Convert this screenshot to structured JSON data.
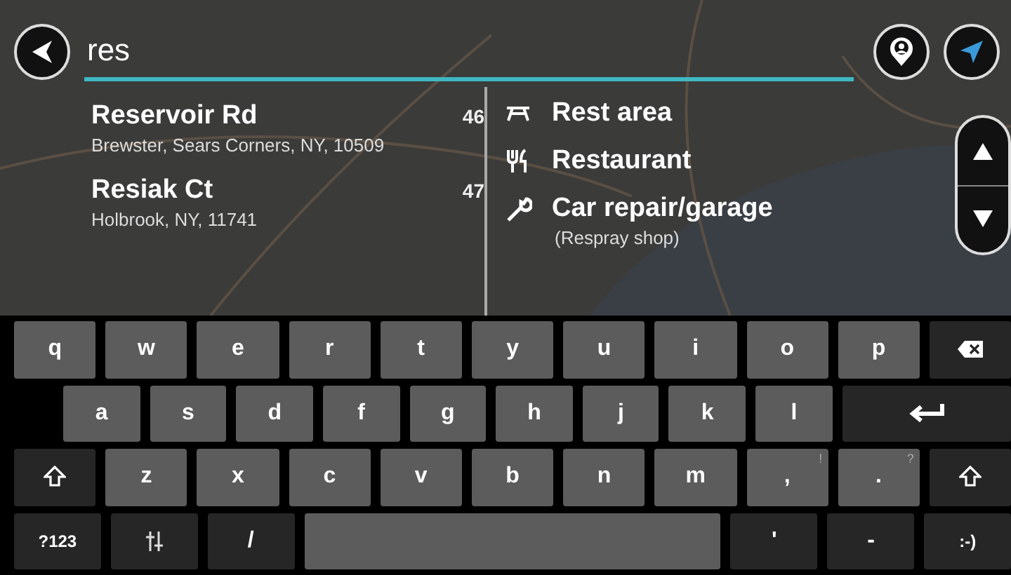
{
  "search": {
    "value": "res"
  },
  "address_results": [
    {
      "name": "Reservoir Rd",
      "address": "Brewster, Sears Corners, NY, 10509",
      "distance": "46"
    },
    {
      "name": "Resiak Ct",
      "address": "Holbrook, NY, 11741",
      "distance": "47"
    }
  ],
  "category_results": [
    {
      "kind": "rest-area",
      "label": "Rest area"
    },
    {
      "kind": "restaurant",
      "label": "Restaurant"
    },
    {
      "kind": "car-repair",
      "label": "Car repair/garage",
      "sublabel": "(Respray shop)"
    }
  ],
  "keyboard": {
    "rows": [
      [
        {
          "kind": "char",
          "label": "q",
          "dark": false
        },
        {
          "kind": "char",
          "label": "w",
          "dark": false
        },
        {
          "kind": "char",
          "label": "e",
          "dark": false
        },
        {
          "kind": "char",
          "label": "r",
          "dark": false
        },
        {
          "kind": "char",
          "label": "t",
          "dark": false
        },
        {
          "kind": "char",
          "label": "y",
          "dark": false
        },
        {
          "kind": "char",
          "label": "u",
          "dark": false
        },
        {
          "kind": "char",
          "label": "i",
          "dark": false
        },
        {
          "kind": "char",
          "label": "o",
          "dark": false
        },
        {
          "kind": "char",
          "label": "p",
          "dark": false
        },
        {
          "kind": "backspace",
          "dark": true
        }
      ],
      [
        {
          "kind": "char",
          "label": "a",
          "dark": false
        },
        {
          "kind": "char",
          "label": "s",
          "dark": false
        },
        {
          "kind": "char",
          "label": "d",
          "dark": false
        },
        {
          "kind": "char",
          "label": "f",
          "dark": false
        },
        {
          "kind": "char",
          "label": "g",
          "dark": false
        },
        {
          "kind": "char",
          "label": "h",
          "dark": false
        },
        {
          "kind": "char",
          "label": "j",
          "dark": false
        },
        {
          "kind": "char",
          "label": "k",
          "dark": false
        },
        {
          "kind": "char",
          "label": "l",
          "dark": false
        },
        {
          "kind": "enter",
          "dark": true
        }
      ],
      [
        {
          "kind": "shift",
          "dark": true
        },
        {
          "kind": "char",
          "label": "z",
          "dark": false
        },
        {
          "kind": "char",
          "label": "x",
          "dark": false
        },
        {
          "kind": "char",
          "label": "c",
          "dark": false
        },
        {
          "kind": "char",
          "label": "v",
          "dark": false
        },
        {
          "kind": "char",
          "label": "b",
          "dark": false
        },
        {
          "kind": "char",
          "label": "n",
          "dark": false
        },
        {
          "kind": "char",
          "label": "m",
          "dark": false
        },
        {
          "kind": "char",
          "label": ",",
          "hint": "!",
          "dark": false
        },
        {
          "kind": "char",
          "label": ".",
          "hint": "?",
          "dark": false
        },
        {
          "kind": "shift",
          "dark": true
        }
      ],
      [
        {
          "kind": "char",
          "label": "?123",
          "dark": true
        },
        {
          "kind": "settings",
          "dark": true
        },
        {
          "kind": "char",
          "label": "/",
          "dark": true
        },
        {
          "kind": "space",
          "dark": false
        },
        {
          "kind": "char",
          "label": "'",
          "dark": true
        },
        {
          "kind": "char",
          "label": "-",
          "dark": true
        },
        {
          "kind": "char",
          "label": ":-)",
          "dark": true
        }
      ]
    ]
  }
}
